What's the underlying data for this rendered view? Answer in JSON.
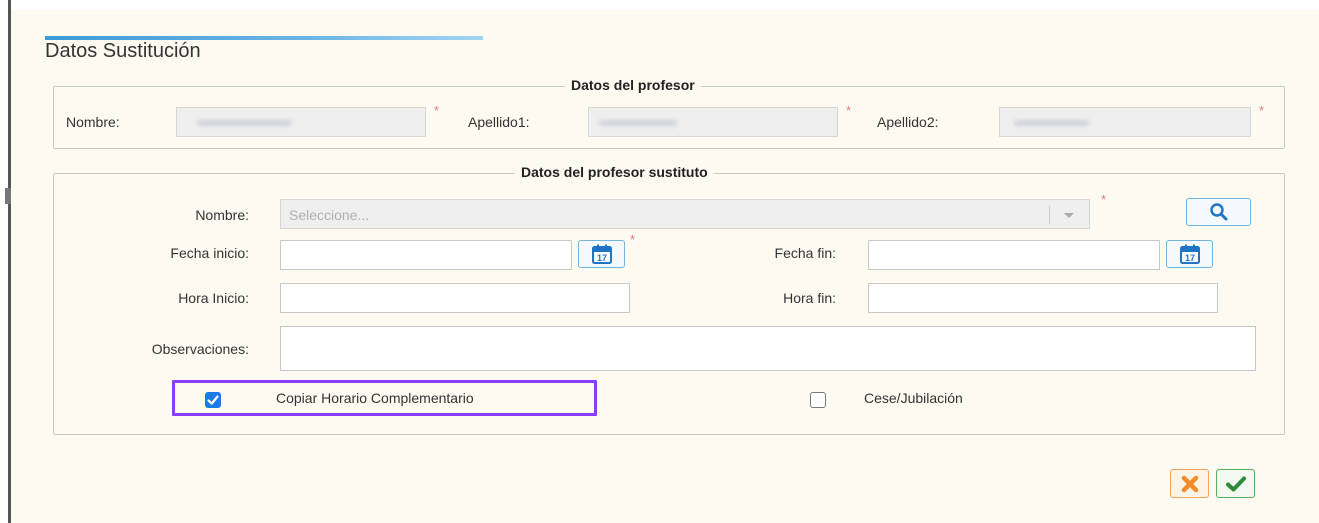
{
  "window": {
    "title": "Datos Sustitución"
  },
  "profesor": {
    "legend": "Datos del profesor",
    "nombre_label": "Nombre:",
    "apellido1_label": "Apellido1:",
    "apellido2_label": "Apellido2:",
    "required_mark": "*"
  },
  "sustituto": {
    "legend": "Datos del profesor sustituto",
    "nombre_label": "Nombre:",
    "nombre_placeholder": "Seleccione...",
    "fecha_inicio_label": "Fecha inicio:",
    "fecha_fin_label": "Fecha fin:",
    "hora_inicio_label": "Hora Inicio:",
    "hora_fin_label": "Hora fin:",
    "observaciones_label": "Observaciones:",
    "calendar_day": "17",
    "required_mark": "*"
  },
  "options": {
    "copiar_horario_label": "Copiar Horario Complementario",
    "copiar_horario_checked": true,
    "cese_label": "Cese/Jubilación",
    "cese_checked": false
  },
  "colors": {
    "accent": "#1a7be5",
    "highlight": "#8b3dff",
    "cancel": "#f28c28",
    "confirm": "#2e8b3a"
  },
  "icons": [
    "search-icon",
    "calendar-icon",
    "check-icon",
    "close-icon"
  ]
}
